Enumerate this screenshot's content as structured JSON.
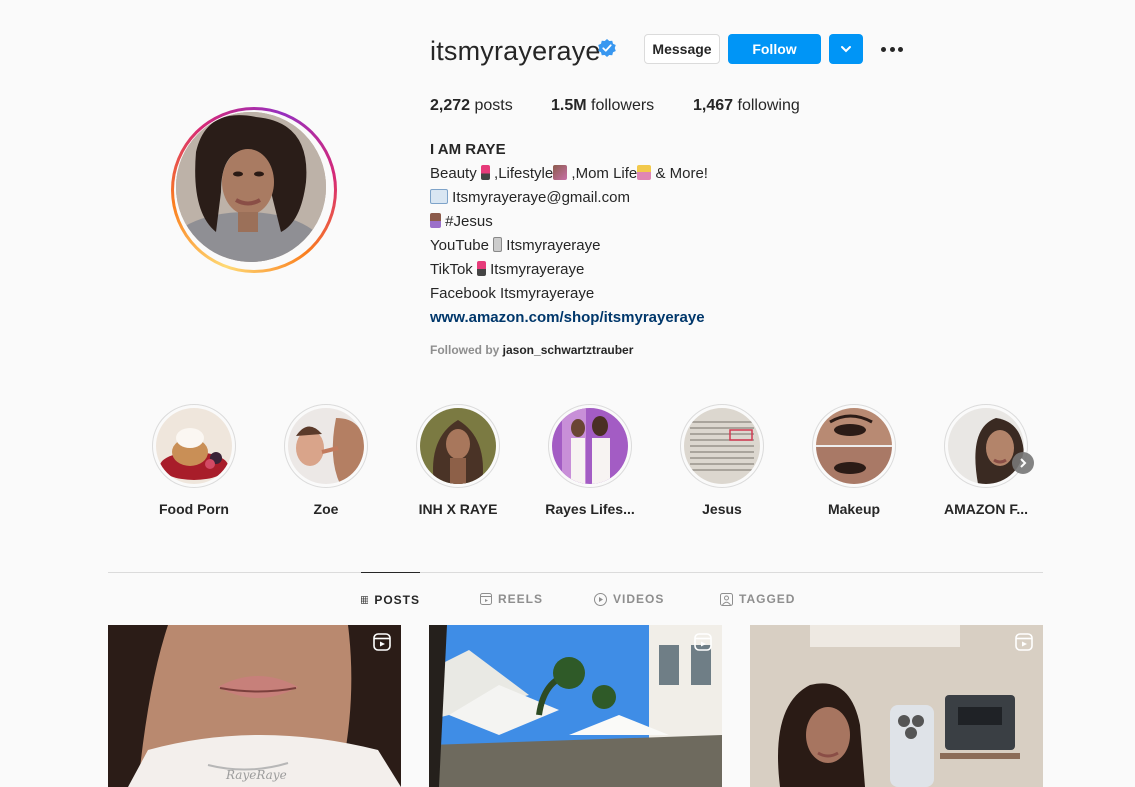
{
  "profile": {
    "username": "itsmyrayeraye",
    "verified": true,
    "buttons": {
      "message": "Message",
      "follow": "Follow"
    },
    "stats": {
      "posts_count": "2,272",
      "posts_label": "posts",
      "followers_count": "1.5M",
      "followers_label": "followers",
      "following_count": "1,467",
      "following_label": "following"
    },
    "bio": {
      "name": "I AM RAYE",
      "line1_a": "Beauty ",
      "line1_b": " ,Lifestyle",
      "line1_c": " ,Mom Life",
      "line1_d": " & More!",
      "email": " Itsmyrayeraye@gmail.com",
      "jesus": "  #Jesus",
      "youtube_label": "YouTube ",
      "youtube_handle": " Itsmyrayeraye",
      "tiktok_label": "TikTok ",
      "tiktok_handle": "  Itsmyrayeraye",
      "facebook": "Facebook Itsmyrayeraye",
      "link": "www.amazon.com/shop/itsmyrayeraye"
    },
    "followed_by_prefix": "Followed by ",
    "followed_by_user": "jason_schwartztrauber"
  },
  "highlights": [
    {
      "label": "Food Porn"
    },
    {
      "label": "Zoe"
    },
    {
      "label": "INH X RAYE"
    },
    {
      "label": "Rayes Lifes..."
    },
    {
      "label": "Jesus"
    },
    {
      "label": "Makeup"
    },
    {
      "label": "AMAZON F..."
    }
  ],
  "tabs": [
    {
      "label": "POSTS",
      "active": true
    },
    {
      "label": "REELS",
      "active": false
    },
    {
      "label": "VIDEOS",
      "active": false
    },
    {
      "label": "TAGGED",
      "active": false
    }
  ],
  "icons": {
    "verified": "verified-badge-icon",
    "dropdown": "chevron-down-icon",
    "more": "more-options-icon",
    "reel": "reel-icon",
    "next": "chevron-right-icon"
  },
  "colors": {
    "accent": "#0095f6",
    "link": "#00376b",
    "muted": "#8e8e8e",
    "text": "#262626"
  }
}
